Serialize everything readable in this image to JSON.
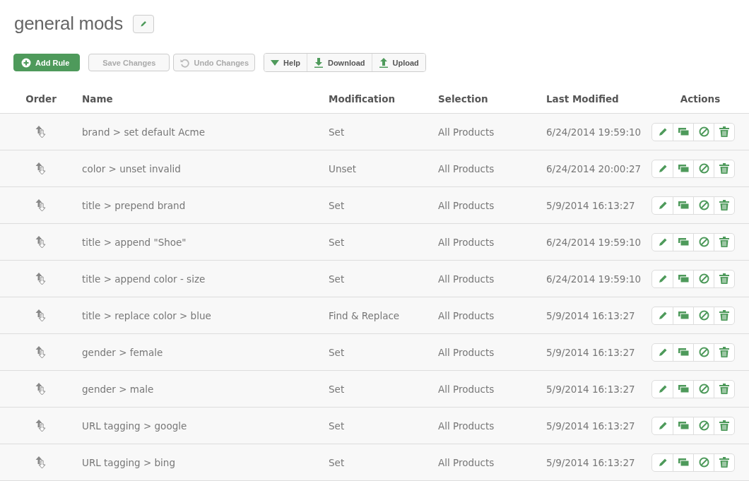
{
  "page": {
    "title": "general mods"
  },
  "toolbar": {
    "add": {
      "label": "Add Rule",
      "disabled": false
    },
    "save": {
      "label": "Save Changes",
      "disabled": true
    },
    "undo": {
      "label": "Undo Changes",
      "disabled": true
    },
    "help": {
      "label": "Help"
    },
    "download": {
      "label": "Download"
    },
    "upload": {
      "label": "Upload"
    }
  },
  "table": {
    "columns": [
      "Order",
      "Name",
      "Modification",
      "Selection",
      "Last Modified",
      "Actions"
    ],
    "rows": [
      {
        "name": "brand > set default Acme",
        "modification": "Set",
        "selection": "All Products",
        "last_modified": "6/24/2014 19:59:10"
      },
      {
        "name": "color > unset invalid",
        "modification": "Unset",
        "selection": "All Products",
        "last_modified": "6/24/2014 20:00:27"
      },
      {
        "name": "title > prepend brand",
        "modification": "Set",
        "selection": "All Products",
        "last_modified": "5/9/2014 16:13:27"
      },
      {
        "name": "title > append \"Shoe\"",
        "modification": "Set",
        "selection": "All Products",
        "last_modified": "6/24/2014 19:59:10"
      },
      {
        "name": "title > append color - size",
        "modification": "Set",
        "selection": "All Products",
        "last_modified": "6/24/2014 19:59:10"
      },
      {
        "name": "title > replace color > blue",
        "modification": "Find & Replace",
        "selection": "All Products",
        "last_modified": "5/9/2014 16:13:27"
      },
      {
        "name": "gender > female",
        "modification": "Set",
        "selection": "All Products",
        "last_modified": "5/9/2014 16:13:27"
      },
      {
        "name": "gender > male",
        "modification": "Set",
        "selection": "All Products",
        "last_modified": "5/9/2014 16:13:27"
      },
      {
        "name": "URL tagging > google",
        "modification": "Set",
        "selection": "All Products",
        "last_modified": "5/9/2014 16:13:27"
      },
      {
        "name": "URL tagging > bing",
        "modification": "Set",
        "selection": "All Products",
        "last_modified": "5/9/2014 16:13:27"
      }
    ]
  }
}
